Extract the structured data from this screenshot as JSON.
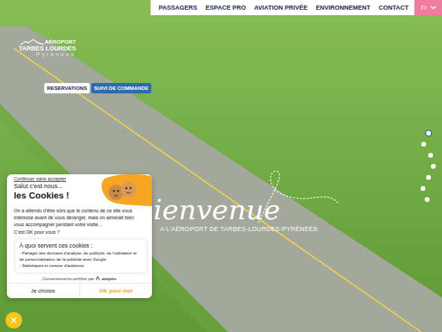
{
  "logo": {
    "line1": "AÉROPORT",
    "line2": "TARBES LOURDES",
    "line3": "Pyrénées"
  },
  "nav": {
    "items": [
      "PASSAGERS",
      "ESPACE PRO",
      "AVIATION PRIVÉE",
      "ENVIRONNEMENT",
      "CONTACT"
    ],
    "language": "Fr"
  },
  "hero_buttons": [
    {
      "label": "RESERVATIONS",
      "kind": "light"
    },
    {
      "label": "SUIVI DE COMMANDE",
      "kind": "primary"
    }
  ],
  "slide_dots": [
    {
      "selected": true
    },
    {
      "selected": false
    },
    {
      "selected": false
    },
    {
      "selected": false
    },
    {
      "selected": false
    },
    {
      "selected": false
    },
    {
      "selected": false
    }
  ],
  "hero": {
    "title": "ienvenue",
    "subtitle": "A L'AÉROPORT DE TARBES-LOURDES-PYRÉNÉES"
  },
  "cookie_banner": {
    "skip_link": "Continuer sans accepter",
    "greeting": "Salut c'est nous...",
    "title": "les Cookies !",
    "body": "On a attendu d'être sûrs que le contenu de ce site vous intéresse avant de vous déranger, mais on aimerait bien vous accompagner pendant votre visite...",
    "question": "C'est OK pour vous ?",
    "purpose_title": "À quoi servent ces cookies :",
    "purposes": [
      "- Partager des données d'analyse, de publicité, de l'utilisateur et de personnalisation de la publicité avec Google",
      "- Statistiques et mesure d'audience"
    ],
    "certified": "Consentements certifiés par",
    "brand": "axeptio",
    "buttons": [
      {
        "label": "Je choisis",
        "kind": "secondary"
      },
      {
        "label": "OK pour moi",
        "kind": "primary"
      }
    ]
  },
  "close_button": {
    "label": "×"
  }
}
